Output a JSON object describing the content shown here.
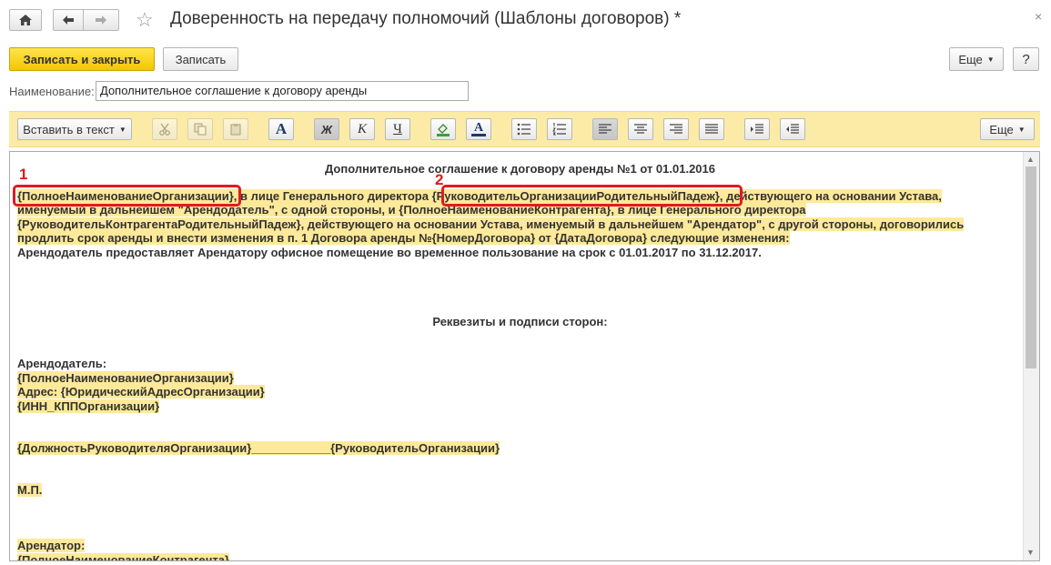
{
  "window": {
    "title": "Доверенность на передачу полномочий (Шаблоны договоров) *",
    "home_icon": "home-icon",
    "back_icon": "arrow-left-icon",
    "forward_icon": "arrow-right-icon",
    "favorite_icon": "star-icon",
    "close_glyph": "×"
  },
  "commandbar": {
    "save_close": "Записать и закрыть",
    "save": "Записать",
    "more": "Еще",
    "help": "?"
  },
  "name_field": {
    "label": "Наименование:",
    "value": "Дополнительное соглашение к договору аренды"
  },
  "toolbar": {
    "insert": "Вставить в текст",
    "bold": "Ж",
    "italic": "К",
    "underline": "Ч",
    "font_glyph": "A",
    "more": "Еще"
  },
  "annotations": {
    "n1": "1",
    "n2": "2"
  },
  "document": {
    "heading": "Дополнительное соглашение к договору аренды №1 от 01.01.2016",
    "p1_token1": "{ПолноеНаименованиеОрганизации}",
    "p1_text1": ", в лице Генерального директора ",
    "p1_token2": "{РуководительОрганизацииРодительныйПадеж}",
    "p1_text2": ", действующего на основании Устава,",
    "p1_line2": "именуемый в дальнейшем \"Арендодатель\", с одной стороны, и {ПолноеНаименованиеКонтрагента}, в лице Генерального директора",
    "p1_line3": "{РуководительКонтрагентаРодительныйПадеж}, действующего на основании Устава, именуемый в дальнейшем \"Арендатор\", с другой стороны, договорились",
    "p1_line4": "продлить срок аренды и внести изменения в п. 1 Договора аренды №{НомерДоговора} от {ДатаДоговора} следующие изменения:",
    "p2": "Арендодатель предоставляет Арендатору офисное помещение во временное пользование на срок с 01.01.2017 по 31.12.2017.",
    "requisites": "Реквезиты и подписи сторон:",
    "lessor": "Арендодатель:",
    "lessor_name": "{ПолноеНаименованиеОрганизации}",
    "lessor_address": "Адрес: {ЮридическийАдресОрганизации}",
    "lessor_inn": "{ИНН_КППОрганизации}",
    "signature_line": "{ДолжностьРуководителяОрганизации}____________{РуководительОрганизации}",
    "stamp": "М.П.",
    "lessee": "Арендатор:",
    "lessee_name": "{ПолноеНаименованиеКонтрагента}"
  }
}
